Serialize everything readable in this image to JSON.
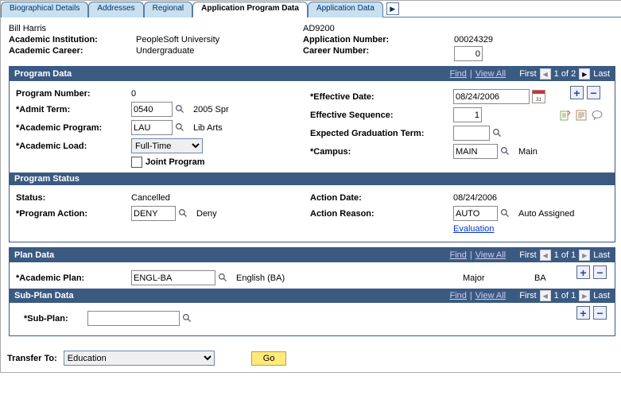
{
  "tabs": {
    "biographical": "Biographical Details",
    "addresses": "Addresses",
    "regional": "Regional",
    "app_prog_data": "Application Program Data",
    "app_data": "Application Data"
  },
  "header": {
    "student_name": "Bill Harris",
    "ad_code": "AD9200",
    "acad_inst_label": "Academic Institution:",
    "acad_inst_value": "PeopleSoft University",
    "app_nbr_label": "Application Number:",
    "app_nbr_value": "00024329",
    "acad_career_label": "Academic Career:",
    "acad_career_value": "Undergraduate",
    "career_nbr_label": "Career Number:",
    "career_nbr_value": "0"
  },
  "nav": {
    "find": "Find",
    "view_all": "View All",
    "first": "First",
    "last": "Last",
    "prog_pos": "1 of 2",
    "plan_pos": "1 of 1",
    "subplan_pos": "1 of 1"
  },
  "sections": {
    "program_data": "Program Data",
    "program_status": "Program Status",
    "plan_data": "Plan Data",
    "sub_plan_data": "Sub-Plan Data"
  },
  "program_data": {
    "program_number_label": "Program Number:",
    "program_number_value": "0",
    "admit_term_label": "*Admit Term:",
    "admit_term_value": "0540",
    "admit_term_desc": "2005 Spr",
    "academic_program_label": "*Academic Program:",
    "academic_program_value": "LAU",
    "academic_program_desc": "Lib Arts",
    "academic_load_label": "*Academic Load:",
    "academic_load_value": "Full-Time",
    "joint_program_label": "Joint Program",
    "effective_date_label": "*Effective Date:",
    "effective_date_value": "08/24/2006",
    "effective_sequence_label": "Effective Sequence:",
    "effective_sequence_value": "1",
    "expected_grad_label": "Expected Graduation Term:",
    "expected_grad_value": "",
    "campus_label": "*Campus:",
    "campus_value": "MAIN",
    "campus_desc": "Main"
  },
  "program_status": {
    "status_label": "Status:",
    "status_value": "Cancelled",
    "program_action_label": "*Program Action:",
    "program_action_value": "DENY",
    "program_action_desc": "Deny",
    "action_date_label": "Action Date:",
    "action_date_value": "08/24/2006",
    "action_reason_label": "Action Reason:",
    "action_reason_value": "AUTO",
    "action_reason_desc": "Auto Assigned",
    "evaluation_link": "Evaluation"
  },
  "plan_data": {
    "academic_plan_label": "*Academic Plan:",
    "academic_plan_value": "ENGL-BA",
    "academic_plan_desc": "English (BA)",
    "plan_type": "Major",
    "degree": "BA"
  },
  "sub_plan_data": {
    "sub_plan_label": "*Sub-Plan:",
    "sub_plan_value": ""
  },
  "footer": {
    "transfer_to_label": "Transfer To:",
    "transfer_to_value": "Education",
    "go_label": "Go"
  },
  "glyph": {
    "plus": "+",
    "minus": "−"
  }
}
